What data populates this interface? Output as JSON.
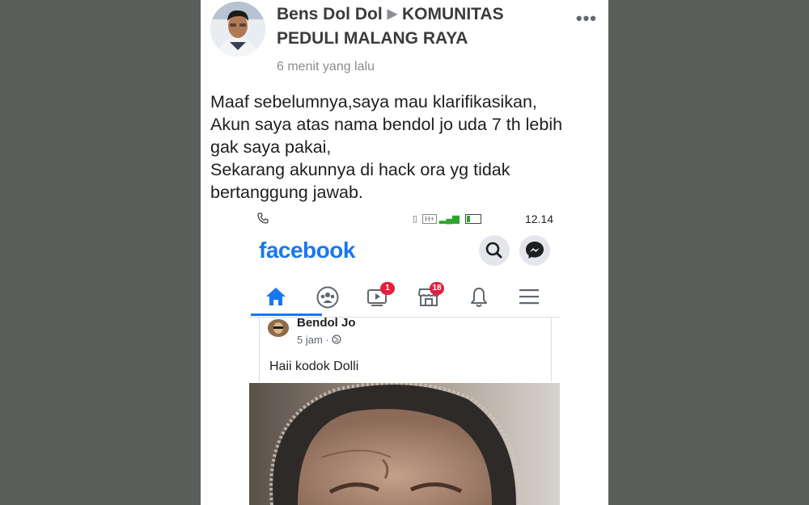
{
  "post": {
    "author": "Bens Dol Dol",
    "group": "KOMUNITAS PEDULI MALANG RAYA",
    "group_line1": "KOMUNITAS",
    "group_line2": "PEDULI MALANG RAYA",
    "time": "6 menit yang lalu",
    "more_icon": "more-options-icon",
    "body_lines": [
      "Maaf sebelumnya,saya mau klarifikasikan,",
      "Akun saya atas nama bendol jo uda 7 th lebih",
      "gak saya pakai,",
      "Sekarang akunnya di hack ora yg tidak",
      "bertanggung jawab."
    ]
  },
  "screenshot": {
    "status_bar": {
      "clock": "12.14",
      "network": "H+",
      "icons": [
        "phone-icon",
        "vibrate-icon",
        "signal-icon",
        "battery-icon"
      ]
    },
    "header": {
      "logo": "facebook",
      "buttons": [
        "search-icon",
        "messenger-icon"
      ]
    },
    "nav": [
      {
        "icon": "home-icon",
        "badge": ""
      },
      {
        "icon": "groups-icon",
        "badge": ""
      },
      {
        "icon": "watch-icon",
        "badge": "1"
      },
      {
        "icon": "marketplace-icon",
        "badge": "18"
      },
      {
        "icon": "bell-icon",
        "badge": ""
      },
      {
        "icon": "menu-icon",
        "badge": ""
      }
    ],
    "inner_post": {
      "author": "Bendol Jo",
      "time": "5 jam ·",
      "privacy_icon": "globe-icon",
      "text": "Haii kodok Dolli"
    }
  },
  "colors": {
    "facebook_blue": "#1877f2",
    "badge_red": "#e41e3f",
    "background": "#5b5f5c"
  }
}
